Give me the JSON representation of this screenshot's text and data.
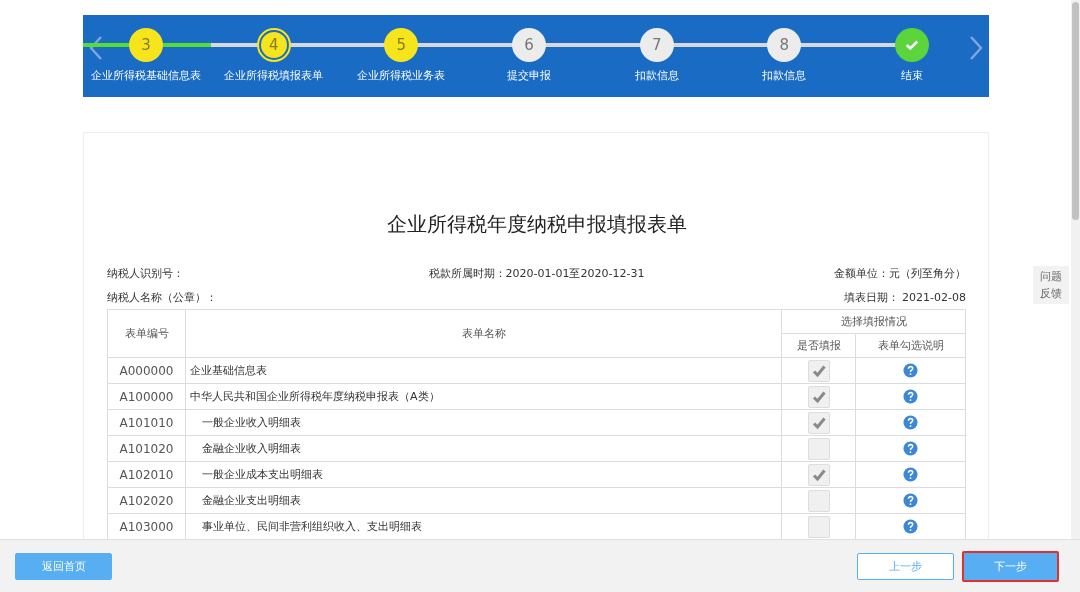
{
  "steps": [
    {
      "kind": "number",
      "number": "3",
      "label": "企业所得税基础信息表",
      "completed": true,
      "selected": false
    },
    {
      "kind": "number",
      "number": "4",
      "label": "企业所得税填报表单",
      "completed": true,
      "selected": true
    },
    {
      "kind": "number",
      "number": "5",
      "label": "企业所得税业务表",
      "completed": true,
      "selected": false
    },
    {
      "kind": "number",
      "number": "6",
      "label": "提交申报",
      "completed": false,
      "selected": false
    },
    {
      "kind": "number",
      "number": "7",
      "label": "扣款信息",
      "completed": false,
      "selected": false
    },
    {
      "kind": "number",
      "number": "8",
      "label": "扣款信息",
      "completed": false,
      "selected": false
    },
    {
      "kind": "end",
      "label": "结束",
      "completed": true
    }
  ],
  "form": {
    "title": "企业所得税年度纳税申报填报表单",
    "info_rows": [
      [
        "纳税人识别号：",
        "税款所属时期：2020-01-01至2020-12-31",
        "金额单位：元（列至角分）"
      ],
      [
        "纳税人名称（公章）：",
        "填表日期： 2021-02-08"
      ]
    ],
    "table": {
      "columns": [
        "表单编号",
        "表单名称",
        "选择填报情况"
      ],
      "subcolumns": [
        "是否填报",
        "表单勾选说明"
      ],
      "rows": [
        {
          "code": "A000000",
          "name": "企业基础信息表",
          "checked": true
        },
        {
          "code": "A100000",
          "name": "中华人民共和国企业所得税年度纳税申报表（A类）",
          "checked": true,
          "children": [
            {
              "code": "A101010",
              "name": "一般企业收入明细表",
              "checked": true
            },
            {
              "code": "A101020",
              "name": "金融企业收入明细表",
              "checked": false
            },
            {
              "code": "A102010",
              "name": "一般企业成本支出明细表",
              "checked": true
            },
            {
              "code": "A102020",
              "name": "金融企业支出明细表",
              "checked": false
            },
            {
              "code": "A103000",
              "name": "事业单位、民间非营利组织收入、支出明细表",
              "checked": false
            }
          ]
        }
      ]
    }
  },
  "feedback": "问题反馈",
  "footer": {
    "home": "返回首页",
    "prev": "上一步",
    "next": "下一步"
  }
}
